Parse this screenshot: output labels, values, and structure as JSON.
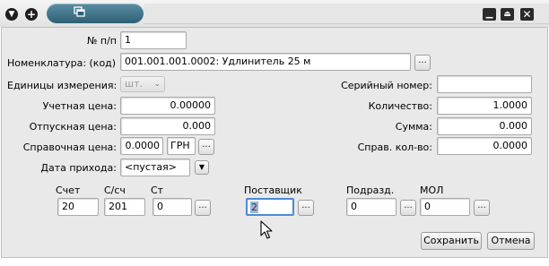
{
  "window": {
    "collapse_icon": "chevron-down-circle-icon",
    "new_icon": "plus-circle-icon",
    "tab_icon": "windows-stack-icon",
    "minimize_icon": "minimize-icon",
    "restore_icon": "restore-icon",
    "close_icon": "close-icon"
  },
  "form": {
    "number": {
      "label": "№ п/п",
      "value": "1"
    },
    "nomenclature": {
      "label": "Номенклатура: (код)",
      "value": "001.001.001.0002: Удлинитель 25 м",
      "button": "..."
    },
    "units": {
      "label": "Единицы измерения:",
      "value": "шт."
    },
    "serial": {
      "label": "Серийный номер:",
      "value": ""
    },
    "account_price": {
      "label": "Учетная цена:",
      "value": "0.00000"
    },
    "quantity": {
      "label": "Количество:",
      "value": "1.0000"
    },
    "sale_price": {
      "label": "Отпускная цена:",
      "value": "0.000"
    },
    "sum": {
      "label": "Сумма:",
      "value": "0.000"
    },
    "ref_price": {
      "label": "Справочная цена:",
      "value": "0.0000",
      "currency": "ГРН",
      "button": "..."
    },
    "ref_qty": {
      "label": "Справ. кол-во:",
      "value": "0.0000"
    },
    "arrival_date": {
      "label": "Дата прихода:",
      "value": "<пустая>"
    }
  },
  "accounts": {
    "account": {
      "label": "Счет",
      "value": "20"
    },
    "subaccount": {
      "label": "С/сч",
      "value": "201"
    },
    "st": {
      "label": "Ст",
      "value": "0",
      "button": "..."
    },
    "supplier": {
      "label": "Поставщик",
      "value": "2",
      "button": "..."
    },
    "division": {
      "label": "Подразд.",
      "value": "0",
      "button": "..."
    },
    "mol": {
      "label": "МОЛ",
      "value": "0",
      "button": "..."
    }
  },
  "actions": {
    "save": "Сохранить",
    "cancel": "Отмена"
  },
  "colors": {
    "tab": "#3e7086",
    "window_bg": "#e9e9e9",
    "focus": "#4a89d6"
  }
}
